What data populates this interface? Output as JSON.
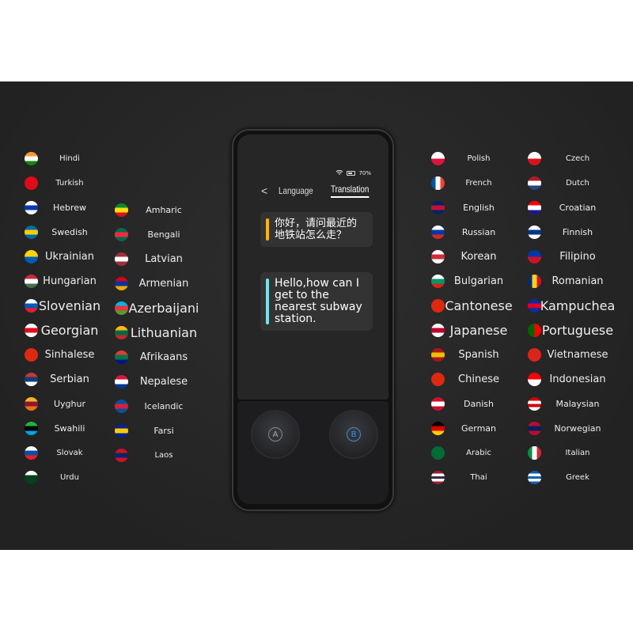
{
  "device": {
    "status": {
      "battery": "70%",
      "wifi_icon": "wifi-icon",
      "battery_icon": "battery-icon"
    },
    "nav": {
      "back": "<",
      "tab_language": "Language",
      "tab_translation": "Translation",
      "active": "Translation"
    },
    "source_text": "你好，请问最近的地铁站怎么走？",
    "target_text": "Hello,how can I get to the nearest subway station.",
    "source_color": "#f4b316",
    "target_color": "#7ee0e6",
    "button_a": "A",
    "button_b": "B",
    "button_b_color": "#3a8fd8"
  },
  "languages": {
    "col1": [
      {
        "name": "Hindi",
        "flag": [
          "#f93",
          "#fff",
          "#138808"
        ]
      },
      {
        "name": "Turkish",
        "flag": [
          "#e30a17"
        ]
      },
      {
        "name": "Hebrew",
        "flag": [
          "#fff",
          "#0038b8",
          "#fff"
        ]
      },
      {
        "name": "Swedish",
        "flag": [
          "#006aa7",
          "#fecc00",
          "#006aa7"
        ]
      },
      {
        "name": "Ukrainian",
        "flag": [
          "#ffd500",
          "#005bbb"
        ]
      },
      {
        "name": "Hungarian",
        "flag": [
          "#ce2939",
          "#fff",
          "#477050"
        ]
      },
      {
        "name": "Slovenian",
        "flag": [
          "#fff",
          "#0057b8",
          "#ed1c24"
        ]
      },
      {
        "name": "Georgian",
        "flag": [
          "#fff",
          "#e30a17",
          "#fff"
        ]
      },
      {
        "name": "Sinhalese",
        "flag": [
          "#de2910"
        ]
      },
      {
        "name": "Serbian",
        "flag": [
          "#c6363c",
          "#0c4076",
          "#fff"
        ]
      },
      {
        "name": "Uyghur",
        "flag": [
          "#f7b718",
          "#8d153a",
          "#eb7400"
        ]
      },
      {
        "name": "Swahili",
        "flag": [
          "#1eb53a",
          "#000",
          "#00a3dd"
        ]
      },
      {
        "name": "Slovak",
        "flag": [
          "#fff",
          "#0b4ea2",
          "#ee1c25"
        ]
      },
      {
        "name": "Urdu",
        "flag": [
          "#fff",
          "#01411c",
          "#01411c"
        ]
      }
    ],
    "col2": [
      {
        "name": "Amharic",
        "flag": [
          "#078930",
          "#fcdd09",
          "#da121a"
        ]
      },
      {
        "name": "Bengali",
        "flag": [
          "#006a4e",
          "#f42a41",
          "#006a4e"
        ]
      },
      {
        "name": "Latvian",
        "flag": [
          "#9e3039",
          "#fff",
          "#9e3039"
        ]
      },
      {
        "name": "Armenian",
        "flag": [
          "#d90012",
          "#0033a0",
          "#f2a800"
        ]
      },
      {
        "name": "Azerbaijani",
        "flag": [
          "#00b5e2",
          "#ef3340",
          "#509e2f"
        ]
      },
      {
        "name": "Lithuanian",
        "flag": [
          "#fdb913",
          "#006a44",
          "#c1272d"
        ]
      },
      {
        "name": "Afrikaans",
        "flag": [
          "#e03c31",
          "#007749",
          "#001489"
        ]
      },
      {
        "name": "Nepalese",
        "flag": [
          "#dc143c",
          "#fff",
          "#003893"
        ]
      },
      {
        "name": "Icelandic",
        "flag": [
          "#02529c",
          "#dc1e35",
          "#02529c"
        ]
      },
      {
        "name": "Farsi",
        "flag": [
          "#002395",
          "#fecb00",
          "#002395"
        ]
      },
      {
        "name": "Laos",
        "flag": [
          "#ce1126",
          "#002868",
          "#ce1126"
        ]
      }
    ],
    "col3": [
      {
        "name": "Polish",
        "flag": [
          "#fff",
          "#dc143c"
        ]
      },
      {
        "name": "French",
        "flag": [
          "#0055a4",
          "#fff",
          "#ef4135"
        ],
        "v": true
      },
      {
        "name": "English",
        "flag": [
          "#012169",
          "#c8102e",
          "#012169"
        ]
      },
      {
        "name": "Russian",
        "flag": [
          "#fff",
          "#0039a6",
          "#d52b1e"
        ]
      },
      {
        "name": "Korean",
        "flag": [
          "#fff",
          "#cd2e3a",
          "#fff"
        ]
      },
      {
        "name": "Bulgarian",
        "flag": [
          "#fff",
          "#00966e",
          "#d62612"
        ]
      },
      {
        "name": "Cantonese",
        "flag": [
          "#de2910"
        ]
      },
      {
        "name": "Japanese",
        "flag": [
          "#fff",
          "#bc002d",
          "#fff"
        ]
      },
      {
        "name": "Spanish",
        "flag": [
          "#aa151b",
          "#f1bf00",
          "#aa151b"
        ]
      },
      {
        "name": "Chinese",
        "flag": [
          "#de2910"
        ]
      },
      {
        "name": "Danish",
        "flag": [
          "#c8102e",
          "#fff",
          "#c8102e"
        ]
      },
      {
        "name": "German",
        "flag": [
          "#000",
          "#dd0000",
          "#ffce00"
        ]
      },
      {
        "name": "Arabic",
        "flag": [
          "#006c35"
        ]
      },
      {
        "name": "Thai",
        "flag": [
          "#a51931",
          "#fff",
          "#2d2a4a",
          "#fff",
          "#a51931"
        ]
      }
    ],
    "col4": [
      {
        "name": "Czech",
        "flag": [
          "#fff",
          "#d7141a"
        ]
      },
      {
        "name": "Dutch",
        "flag": [
          "#ae1c28",
          "#fff",
          "#21468b"
        ]
      },
      {
        "name": "Croatian",
        "flag": [
          "#ff0000",
          "#fff",
          "#171796"
        ]
      },
      {
        "name": "Finnish",
        "flag": [
          "#fff",
          "#003580",
          "#fff"
        ]
      },
      {
        "name": "Filipino",
        "flag": [
          "#0038a8",
          "#ce1126"
        ]
      },
      {
        "name": "Romanian",
        "flag": [
          "#002b7f",
          "#fcd116",
          "#ce1126"
        ],
        "v": true
      },
      {
        "name": "Kampuchea",
        "flag": [
          "#032ea1",
          "#e00025",
          "#032ea1"
        ]
      },
      {
        "name": "Portuguese",
        "flag": [
          "#006600",
          "#ff0000"
        ],
        "v": true
      },
      {
        "name": "Vietnamese",
        "flag": [
          "#da251d"
        ]
      },
      {
        "name": "Indonesian",
        "flag": [
          "#ff0000",
          "#fff"
        ]
      },
      {
        "name": "Malaysian",
        "flag": [
          "#cc0001",
          "#fff",
          "#cc0001",
          "#fff"
        ]
      },
      {
        "name": "Norwegian",
        "flag": [
          "#ba0c2f",
          "#00205b",
          "#ba0c2f"
        ]
      },
      {
        "name": "Italian",
        "flag": [
          "#009246",
          "#fff",
          "#ce2b37"
        ],
        "v": true
      },
      {
        "name": "Greek",
        "flag": [
          "#0d5eaf",
          "#fff",
          "#0d5eaf",
          "#fff",
          "#0d5eaf"
        ]
      }
    ]
  }
}
